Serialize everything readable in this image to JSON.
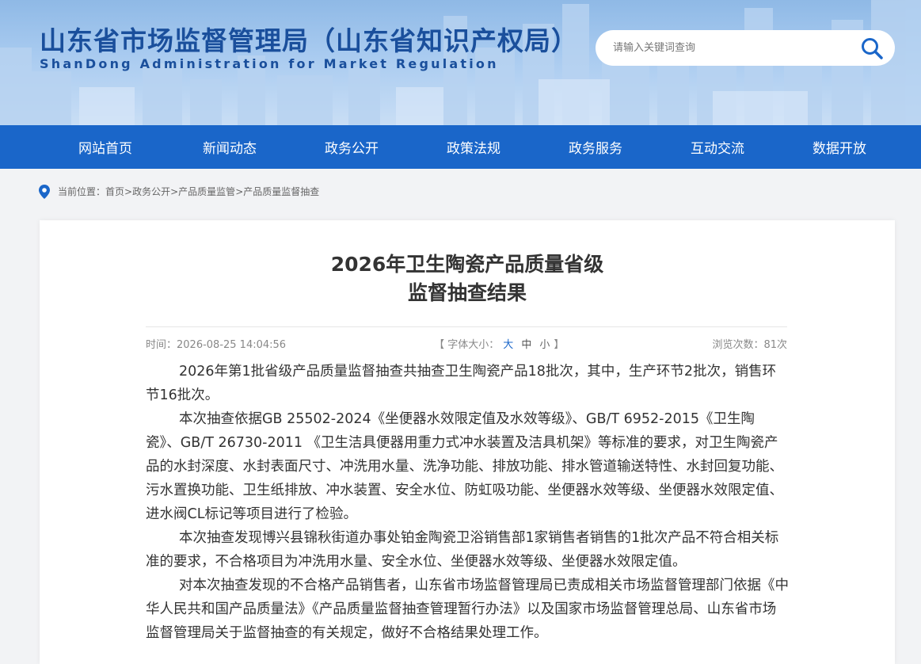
{
  "header": {
    "title": "山东省市场监督管理局（山东省知识产权局）",
    "subtitle": "ShanDong Administration for Market Regulation",
    "search_placeholder": "请输入关键词查询"
  },
  "nav": {
    "items": [
      "网站首页",
      "新闻动态",
      "政务公开",
      "政策法规",
      "政务服务",
      "互动交流",
      "数据开放"
    ]
  },
  "breadcrumb": {
    "prefix": "当前位置：",
    "items": [
      "首页",
      "政务公开",
      "产品质量监管",
      "产品质量监督抽查"
    ],
    "separator": ">"
  },
  "article": {
    "title_line1": "2026年卫生陶瓷产品质量省级",
    "title_line2": "监督抽查结果",
    "time": "时间：2026-08-25 14:04:56",
    "font_size_label": "【 字体大小：",
    "font_size_large": "大",
    "font_size_medium": "中",
    "font_size_small": "小",
    "font_size_end": "】",
    "views": "浏览次数：81次",
    "paragraphs": [
      "2026年第1批省级产品质量监督抽查共抽查卫生陶瓷产品18批次，其中，生产环节2批次，销售环节16批次。",
      "本次抽查依据GB 25502-2024《坐便器水效限定值及水效等级》、GB/T 6952-2015《卫生陶瓷》、GB/T 26730-2011 《卫生洁具便器用重力式冲水装置及洁具机架》等标准的要求，对卫生陶瓷产品的水封深度、水封表面尺寸、冲洗用水量、洗净功能、排放功能、排水管道输送特性、水封回复功能、污水置换功能、卫生纸排放、冲水装置、安全水位、防虹吸功能、坐便器水效等级、坐便器水效限定值、进水阀CL标记等项目进行了检验。",
      "本次抽查发现博兴县锦秋街道办事处铂金陶瓷卫浴销售部1家销售者销售的1批次产品不符合相关标准的要求，不合格项目为冲洗用水量、安全水位、坐便器水效等级、坐便器水效限定值。",
      "对本次抽查发现的不合格产品销售者，山东省市场监督管理局已责成相关市场监督管理部门依据《中华人民共和国产品质量法》《产品质量监督抽查管理暂行办法》以及国家市场监督管理总局、山东省市场监督管理局关于监督抽查的有关规定，做好不合格结果处理工作。"
    ]
  },
  "colors": {
    "brand_blue": "#1a66c9",
    "title_blue": "#1a4f9c",
    "text": "#333333"
  },
  "icons": {
    "search": "search-icon",
    "location": "location-pin-icon"
  }
}
